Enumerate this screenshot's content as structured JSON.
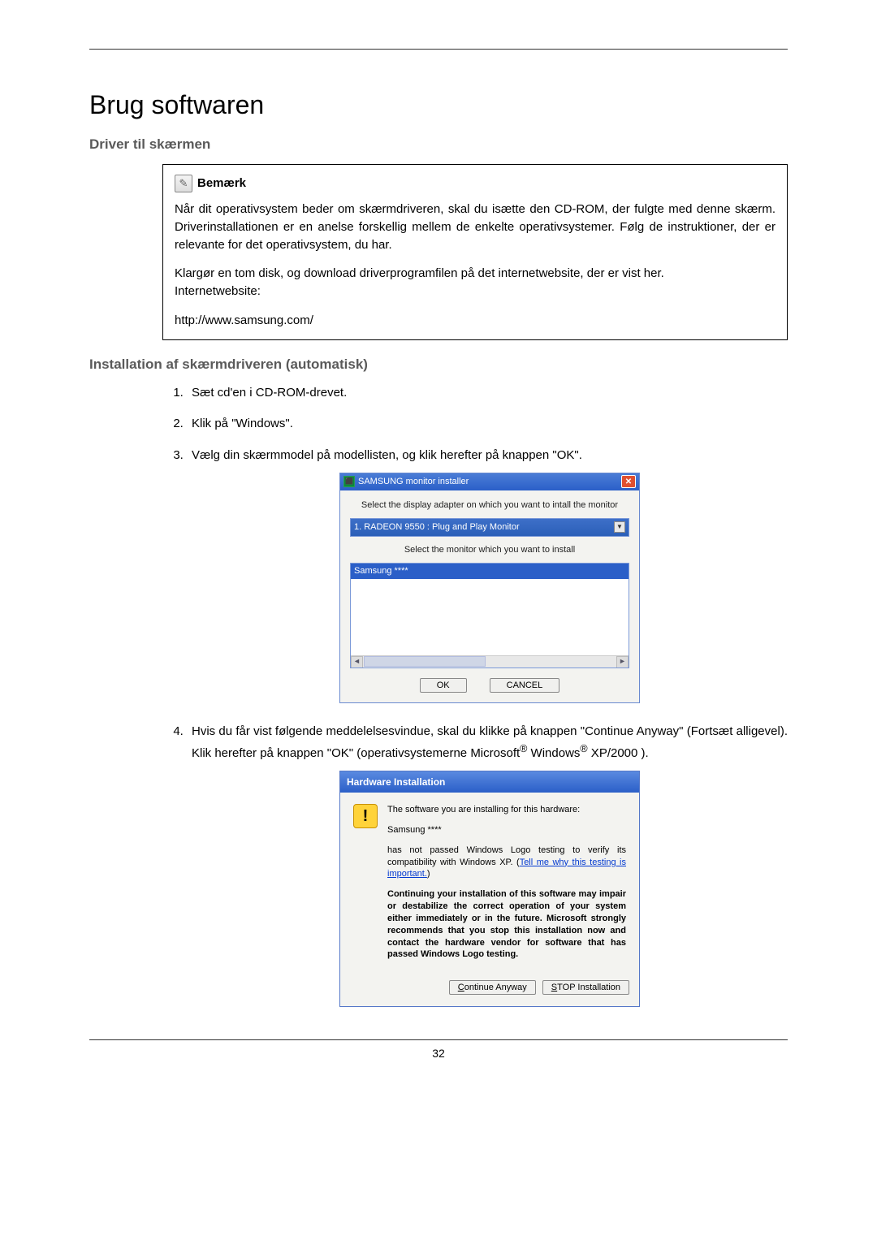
{
  "page": {
    "title": "Brug softwaren",
    "section1": "Driver til skærmen",
    "section2": "Installation af skærmdriveren (automatisk)",
    "page_number": "32"
  },
  "note": {
    "title": "Bemærk",
    "p1": "Når dit operativsystem beder om skærmdriveren, skal du isætte den CD-ROM, der fulgte med denne skærm. Driverinstallationen er en anelse forskellig mellem de enkelte operativsystemer. Følg de instruktioner, der er relevante for det operativsystem, du har.",
    "p2": "Klargør en tom disk, og download driverprogramfilen på det internetwebsite, der er vist her.",
    "label": "Internetwebsite:",
    "url": "http://www.samsung.com/"
  },
  "steps": {
    "s1": "Sæt cd'en i CD-ROM-drevet.",
    "s2": "Klik på \"Windows\".",
    "s3": "Vælg din skærmmodel på modellisten, og klik herefter på knappen \"OK\".",
    "s4_a": "Hvis du får vist følgende meddelelsesvindue, skal du klikke på knappen \"Continue Anyway\" (Fortsæt alligevel). Klik herefter på knappen \"OK\" (operativsystemerne Microsoft",
    "s4_b": " Windows",
    "s4_c": " XP/2000 )."
  },
  "installer": {
    "title": "SAMSUNG monitor installer",
    "label1": "Select the display adapter on which you want to intall the monitor",
    "combo": "1. RADEON 9550 : Plug and Play Monitor",
    "label2": "Select the monitor which you want to install",
    "selected": "Samsung ****",
    "ok": "OK",
    "cancel": "CANCEL"
  },
  "hw": {
    "title": "Hardware Installation",
    "l1": "The software you are installing for this hardware:",
    "l2": "Samsung ****",
    "l3a": "has not passed Windows Logo testing to verify its compatibility with Windows XP. (",
    "link": "Tell me why this testing is important.",
    "l3b": ")",
    "l4": "Continuing your installation of this software may impair or destabilize the correct operation of your system either immediately or in the future. Microsoft strongly recommends that you stop this installation now and contact the hardware vendor for software that has passed Windows Logo testing.",
    "btn1_u": "C",
    "btn1_rest": "ontinue Anyway",
    "btn2_u": "S",
    "btn2_rest": "TOP Installation"
  }
}
